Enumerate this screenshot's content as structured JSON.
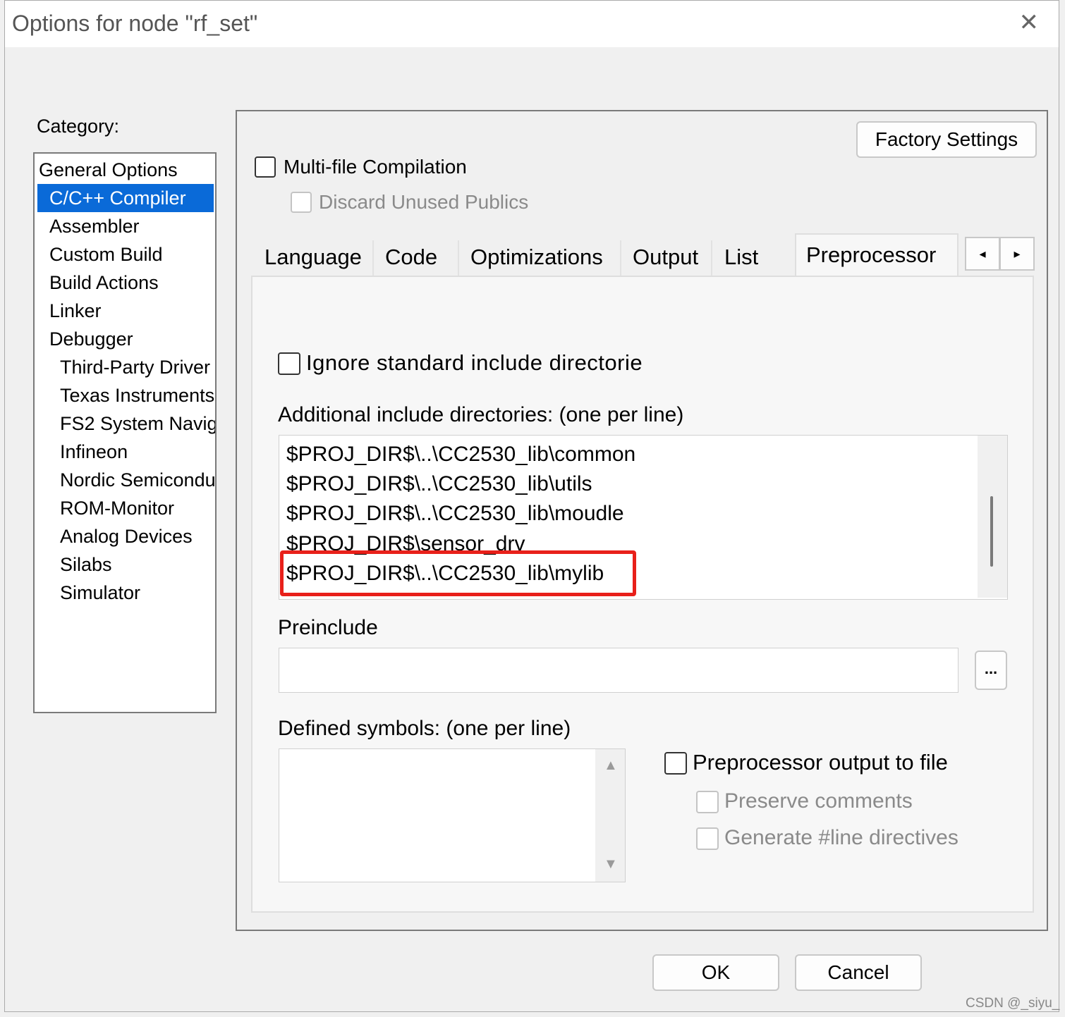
{
  "window": {
    "title": "Options for node \"rf_set\""
  },
  "category": {
    "label": "Category:",
    "items": [
      "General Options",
      "C/C++ Compiler",
      "Assembler",
      "Custom Build",
      "Build Actions",
      "Linker",
      "Debugger",
      "Third-Party Driver",
      "Texas Instruments",
      "FS2 System Navig",
      "Infineon",
      "Nordic Semiconduc",
      "ROM-Monitor",
      "Analog Devices",
      "Silabs",
      "Simulator"
    ],
    "selected": "C/C++ Compiler"
  },
  "panel": {
    "factory_settings_label": "Factory Settings",
    "multifile_label": "Multi-file Compilation",
    "discard_label": "Discard Unused Publics",
    "tabs": [
      "Language",
      "Code",
      "Optimizations",
      "Output",
      "List",
      "Preprocessor"
    ],
    "active_tab": "Preprocessor",
    "tab_scroll_left": "◂",
    "tab_scroll_right": "▸"
  },
  "preprocessor": {
    "ignore_std_label": "Ignore standard include directorie",
    "additional_label": "Additional include directories: (one per line)",
    "include_dirs": [
      "$PROJ_DIR$\\..\\CC2530_lib\\common",
      "$PROJ_DIR$\\..\\CC2530_lib\\utils",
      "$PROJ_DIR$\\..\\CC2530_lib\\moudle",
      "$PROJ_DIR$\\sensor_drv",
      "$PROJ_DIR$\\..\\CC2530_lib\\mylib"
    ],
    "highlight_color": "#e8201a",
    "preinclude_label": "Preinclude",
    "preinclude_value": "",
    "browse_label": "...",
    "defined_label": "Defined symbols: (one per line)",
    "output_file_label": "Preprocessor output to file",
    "preserve_label": "Preserve comments",
    "line_directives_label": "Generate #line directives"
  },
  "footer": {
    "ok_label": "OK",
    "cancel_label": "Cancel",
    "watermark": "CSDN @_siyu_"
  }
}
